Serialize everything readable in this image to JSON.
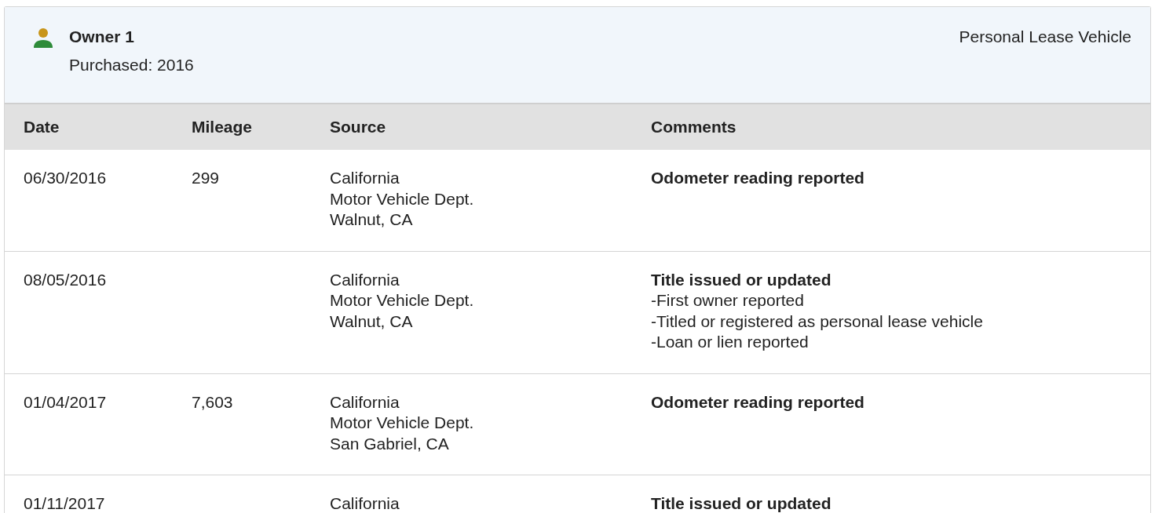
{
  "owner": {
    "name": "Owner 1",
    "purchased": "Purchased: 2016",
    "type": "Personal Lease Vehicle"
  },
  "table": {
    "columns": [
      "Date",
      "Mileage",
      "Source",
      "Comments"
    ],
    "rows": [
      {
        "date": "06/30/2016",
        "mileage": "299",
        "source": [
          "California",
          "Motor Vehicle Dept.",
          "Walnut, CA"
        ],
        "comment_title": "Odometer reading reported",
        "comment_items": []
      },
      {
        "date": "08/05/2016",
        "source": [
          "California",
          "Motor Vehicle Dept.",
          "Walnut, CA"
        ],
        "comment_title": "Title issued or updated",
        "comment_items": [
          "-First owner reported",
          "-Titled or registered as personal lease vehicle",
          "-Loan or lien reported"
        ]
      },
      {
        "date": "01/04/2017",
        "mileage": "7,603",
        "source": [
          "California",
          "Motor Vehicle Dept.",
          "San Gabriel, CA"
        ],
        "comment_title": "Odometer reading reported",
        "comment_items": []
      },
      {
        "date": "01/11/2017",
        "source": [
          "California"
        ],
        "comment_title": "Title issued or updated",
        "comment_items": []
      }
    ]
  }
}
